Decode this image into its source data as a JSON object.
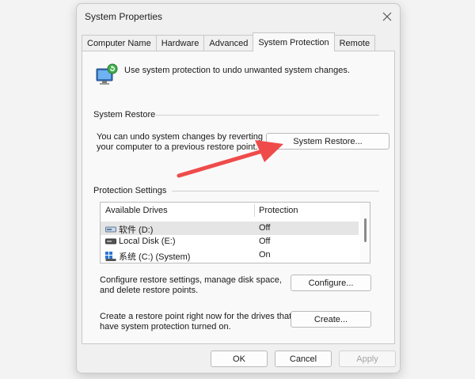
{
  "window": {
    "title": "System Properties"
  },
  "tabs": [
    {
      "label": "Computer Name"
    },
    {
      "label": "Hardware"
    },
    {
      "label": "Advanced"
    },
    {
      "label": "System Protection"
    },
    {
      "label": "Remote"
    }
  ],
  "active_tab": "System Protection",
  "intro_text": "Use system protection to undo unwanted system changes.",
  "restore": {
    "group_label": "System Restore",
    "desc_line1": "You can undo system changes by reverting",
    "desc_line2": "your computer to a previous restore point.",
    "button_label": "System Restore..."
  },
  "protection": {
    "group_label": "Protection Settings",
    "columns": [
      "Available Drives",
      "Protection"
    ],
    "drives": [
      {
        "name": "软件 (D:)",
        "protection": "Off",
        "icon": "drive-icon"
      },
      {
        "name": "Local Disk (E:)",
        "protection": "Off",
        "icon": "drive-icon"
      },
      {
        "name": "系统 (C:) (System)",
        "protection": "On",
        "icon": "system-drive-icon"
      }
    ],
    "configure_desc_line1": "Configure restore settings, manage disk space,",
    "configure_desc_line2": "and delete restore points.",
    "configure_button": "Configure...",
    "create_desc_line1": "Create a restore point right now for the drives that",
    "create_desc_line2": "have system protection turned on.",
    "create_button": "Create..."
  },
  "footer": {
    "ok": "OK",
    "cancel": "Cancel",
    "apply": "Apply"
  },
  "annotation": {
    "color": "#ef4b4b"
  }
}
